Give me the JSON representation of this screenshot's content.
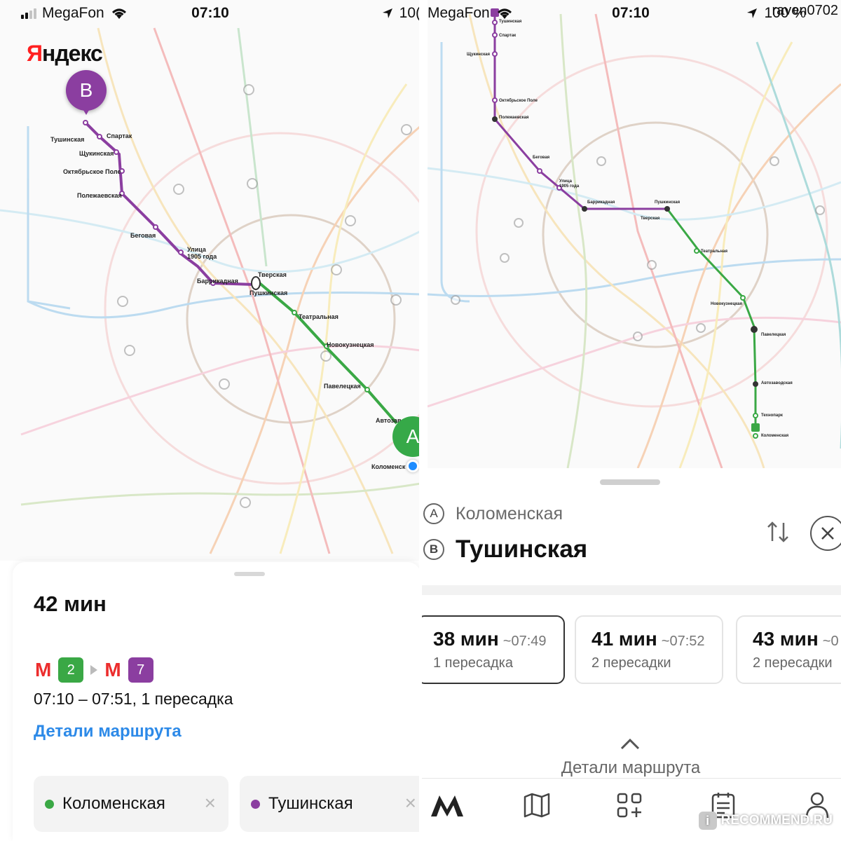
{
  "left": {
    "status": {
      "carrier": "MegaFon",
      "time": "07:10",
      "battery": "10("
    },
    "logo": {
      "first": "Я",
      "rest": "ндекс"
    },
    "pins": {
      "b": "B",
      "a": "A"
    },
    "map_labels": {
      "tushinskaya": "Тушинская",
      "spartak": "Спартак",
      "shchukinskaya": "Щукинская",
      "oktyabrskoe_pole": "Октябрьское Поле",
      "polezhaevskaya": "Полежаевская",
      "begovaya": "Беговая",
      "ulitsa_1905_a": "Улица",
      "ulitsa_1905_b": "1905 года",
      "barrikadnaya": "Баррикадная",
      "tverskaya": "Тверская",
      "pushkinskaya": "Пушкинская",
      "teatralnaya": "Театральная",
      "novokuznetskaya": "Новокузнецкая",
      "paveletskaya": "Павелецкая",
      "avtozavodskaya": "Автозав",
      "kolomenskaya": "Коломенск"
    },
    "sheet": {
      "duration": "42 мин",
      "metro_glyph": "М",
      "line_from": "2",
      "line_to": "7",
      "times": "07:10 – 07:51, 1 пересадка",
      "details_link": "Детали маршрута",
      "chip_from": "Коломенская",
      "chip_to": "Тушинская",
      "chip_close": "×"
    }
  },
  "right": {
    "status": {
      "carrier": "MegaFon",
      "time": "07:10",
      "battery": "100 %"
    },
    "watermark_user": "raven0702",
    "map_labels": {
      "tushinskaya": "Тушинская",
      "spartak": "Спартак",
      "shchukinskaya": "Щукинская",
      "oktyabrskoe_pole": "Октябрьское Поле",
      "polezhaevskaya": "Полежаевская",
      "begovaya": "Беговая",
      "ulitsa_1905_a": "Улица",
      "ulitsa_1905_b": "1905 года",
      "barrikadnaya": "Баррикадная",
      "pushkinskaya": "Пушкинская",
      "tverskaya": "Тверская",
      "teatralnaya": "Театральная",
      "novokuznetskaya": "Новокузнецкая",
      "paveletskaya": "Павелецкая",
      "avtozavodskaya": "Автозаводская",
      "tekhnopark": "Технопарк",
      "kolomenskaya": "Коломенская"
    },
    "sheet": {
      "from_letter": "A",
      "from_station": "Коломенская",
      "to_letter": "B",
      "to_station": "Тушинская",
      "options": [
        {
          "mins": "38 мин",
          "eta": "~07:49",
          "transfers": "1 пересадка"
        },
        {
          "mins": "41 мин",
          "eta": "~07:52",
          "transfers": "2 пересадки"
        },
        {
          "mins": "43 мин",
          "eta": "~0",
          "transfers": "2 пересадки"
        }
      ],
      "details_toggle": "Детали маршрута"
    },
    "watermark_site": "RECOMMEND.RU",
    "watermark_site_badge": "i"
  },
  "colors": {
    "line2_green": "#3aa845",
    "line7_purple": "#8b3ea0",
    "metro_red": "#ec2d2d",
    "link_blue": "#2d8ae8"
  }
}
